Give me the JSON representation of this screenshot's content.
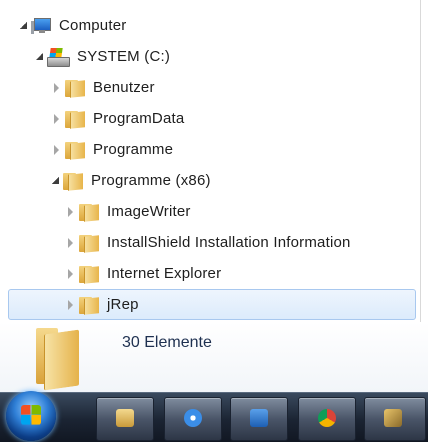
{
  "tree": {
    "items": [
      {
        "label": "Computer",
        "icon": "computer-icon",
        "expanded": true
      },
      {
        "label": "SYSTEM (C:)",
        "icon": "drive-icon",
        "expanded": true
      },
      {
        "label": "Benutzer",
        "icon": "folder-icon",
        "expanded": false
      },
      {
        "label": "ProgramData",
        "icon": "folder-icon",
        "expanded": false
      },
      {
        "label": "Programme",
        "icon": "folder-icon",
        "expanded": false
      },
      {
        "label": "Programme (x86)",
        "icon": "folder-icon",
        "expanded": true
      },
      {
        "label": "ImageWriter",
        "icon": "folder-icon",
        "expanded": false
      },
      {
        "label": "InstallShield Installation Information",
        "icon": "folder-icon",
        "expanded": false
      },
      {
        "label": "Internet Explorer",
        "icon": "folder-icon",
        "expanded": false
      },
      {
        "label": "jRep",
        "icon": "folder-icon",
        "expanded": false,
        "selected": true
      }
    ]
  },
  "details": {
    "item_count": "30 Elemente",
    "icon": "folder-icon"
  },
  "taskbar": {
    "start_icon": "windows-start-icon",
    "buttons": [
      {
        "icon": "file-explorer-icon"
      },
      {
        "icon": "safari-icon"
      },
      {
        "icon": "outlook-icon"
      },
      {
        "icon": "chrome-icon"
      },
      {
        "icon": "app-icon"
      }
    ]
  },
  "colors": {
    "selection_border": "#a8c8ef",
    "selection_fill": "#dcebfc",
    "taskbar": "#1b2433"
  }
}
